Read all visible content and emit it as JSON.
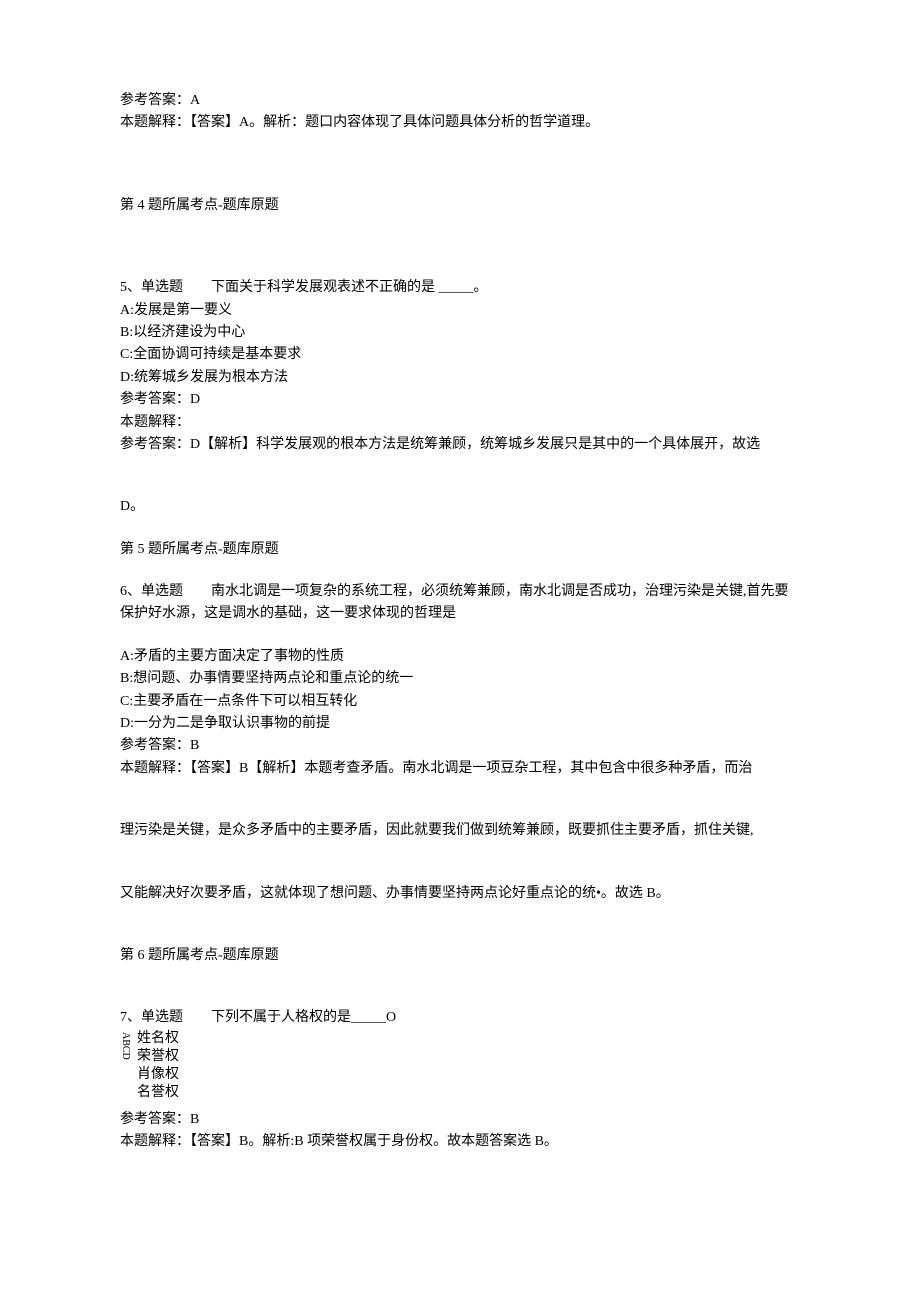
{
  "q4_answer_label": "参考答案：A",
  "q4_explain": "本题解释：【答案】A。解析：题口内容体现了具体问题具体分析的哲学道理。",
  "q4_topic": "第 4 题所属考点-题库原题",
  "q5_head_prefix": "5、单选题　　下面关于科学发展观表述不正确的是 _____。",
  "q5_optA": "A:发展是第一要义",
  "q5_optB": "B:以经济建设为中心",
  "q5_optC": "C:全面协调可持续是基本要求",
  "q5_optD": "D:统筹城乡发展为根本方法",
  "q5_answer_label": "参考答案：D",
  "q5_explain_label": "本题解释：",
  "q5_explain_line1": "参考答案：D【解析】科学发展观的根本方法是统筹兼顾，统筹城乡发展只是其中的一个具体展开，故选",
  "q5_explain_line2": "D。",
  "q5_topic": "第 5 题所属考点-题库原题",
  "q6_head": "6、单选题　　南水北调是一项复杂的系统工程，必须统筹兼顾，南水北调是否成功，治理污染是关键,首先要保护好水源，这是调水的基础，这一要求体现的哲理是",
  "q6_optA": "A:矛盾的主要方面决定了事物的性质",
  "q6_optB": "B:想问题、办事情要坚持两点论和重点论的统一",
  "q6_optC": "C:主要矛盾在一点条件下可以相互转化",
  "q6_optD": "D:一分为二是争取认识事物的前提",
  "q6_answer_label": "参考答案：B",
  "q6_explain_line1": "本题解释：【答案】B【解析】本题考查矛盾。南水北调是一项豆杂工程，其中包含中很多种矛盾，而治",
  "q6_explain_line2": "理污染是关键，是众多矛盾中的主要矛盾，因此就要我们做到统筹兼顾，既要抓住主要矛盾，抓住关键,",
  "q6_explain_line3": "又能解决好次要矛盾，这就体现了想问题、办事情要坚持两点论好重点论的统•。故选 B。",
  "q6_topic": "第 6 题所属考点-题库原题",
  "q7_head": "7、单选题　　下列不属于人格权的是_____O",
  "q7_labels": "ABCD",
  "q7_optA": "姓名权",
  "q7_optB": "荣誉权",
  "q7_optC": "肖像权",
  "q7_optD": "名誉权",
  "q7_answer_label": "参考答案：B",
  "q7_explain": "本题解释：【答案】B。解析:B 项荣誉权属于身份权。故本题答案选 B。"
}
